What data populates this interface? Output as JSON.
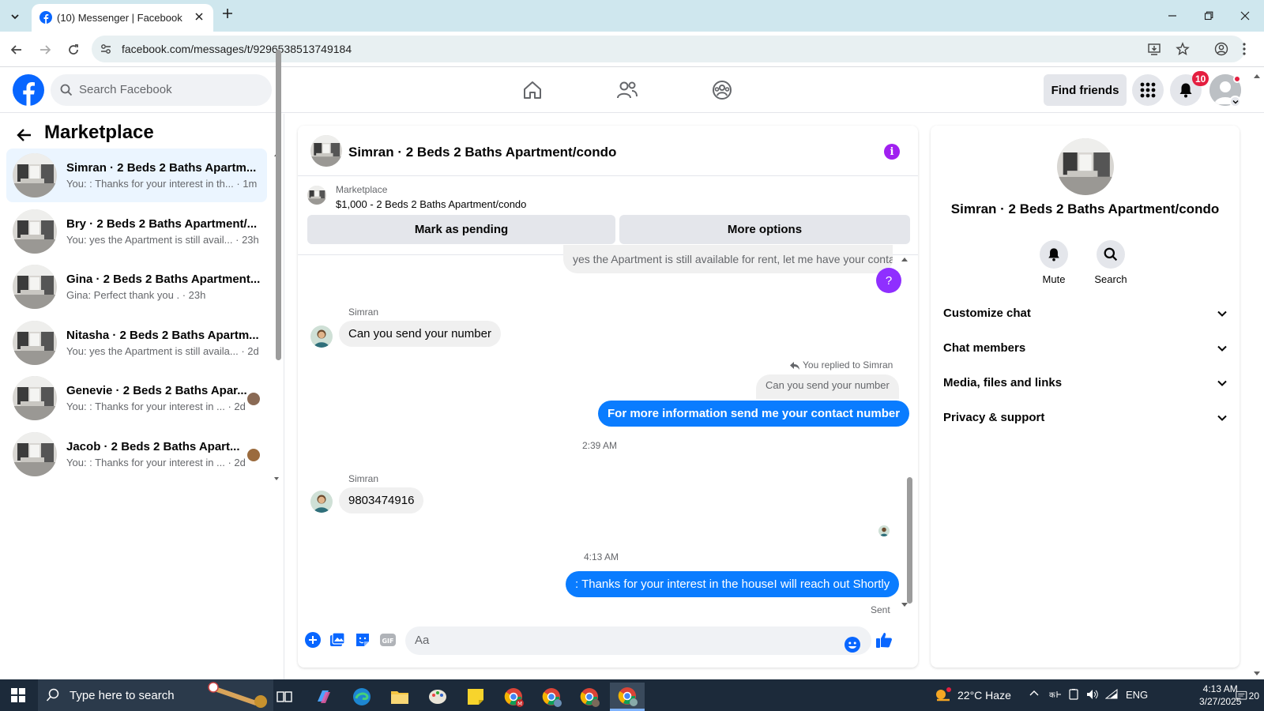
{
  "browser": {
    "tab_title": "(10) Messenger | Facebook",
    "url": "facebook.com/messages/t/9296538513749184"
  },
  "fb": {
    "search_placeholder": "Search Facebook",
    "find_friends": "Find friends",
    "notification_count": "10",
    "brand_color": "#0866ff"
  },
  "sidebar": {
    "title": "Marketplace",
    "conversations": [
      {
        "name": "Simran · 2 Beds 2 Baths Apartm...",
        "snippet": "You: : Thanks for your interest in th... · 1m",
        "active": true
      },
      {
        "name": "Bry · 2 Beds 2 Baths Apartment/...",
        "snippet": "You: yes the Apartment is still avail... · 23h",
        "active": false
      },
      {
        "name": "Gina · 2 Beds 2 Baths Apartment...",
        "snippet": "Gina: Perfect thank you . · 23h",
        "active": false
      },
      {
        "name": "Nitasha · 2 Beds 2 Baths Apartm...",
        "snippet": "You: yes the Apartment is still availa... · 2d",
        "active": false
      },
      {
        "name": "Genevie · 2 Beds 2 Baths Apar...",
        "snippet": "You: : Thanks for your interest in ... · 2d",
        "active": false
      },
      {
        "name": "Jacob · 2 Beds 2 Baths Apart...",
        "snippet": "You: : Thanks for your interest in ... · 2d",
        "active": false
      }
    ]
  },
  "chat": {
    "title": "Simran · 2 Beds 2 Baths Apartment/condo",
    "marketplace_label": "Marketplace",
    "listing": "$1,000 - 2 Beds 2 Baths Apartment/condo",
    "mark_pending": "Mark as pending",
    "more_options": "More options",
    "messages": {
      "prev_out": "yes the Apartment is still available for rent, let me have your contact ...",
      "sender1": "Simran",
      "in1": "Can you send your number",
      "replied_label": "You replied to Simran",
      "reply_quote": "Can you send your number",
      "out1": "For more information send me your contact number",
      "time1": "2:39 AM",
      "sender2": "Simran",
      "in2": "9803474916",
      "time2": "4:13 AM",
      "out2": ": Thanks for your interest in the houseI will reach out Shortly",
      "status": "Sent"
    },
    "composer_placeholder": "Aa",
    "accent": "#0a7cff"
  },
  "right_panel": {
    "name": "Simran · 2 Beds 2 Baths Apartment/condo",
    "mute": "Mute",
    "search": "Search",
    "sections": [
      "Customize chat",
      "Chat members",
      "Media, files and links",
      "Privacy & support"
    ]
  },
  "taskbar": {
    "search_text": "Type here to search",
    "weather": "22°C  Haze",
    "lang": "ENG",
    "time": "4:13 AM",
    "date": "3/27/2025",
    "notif_count": "20"
  }
}
